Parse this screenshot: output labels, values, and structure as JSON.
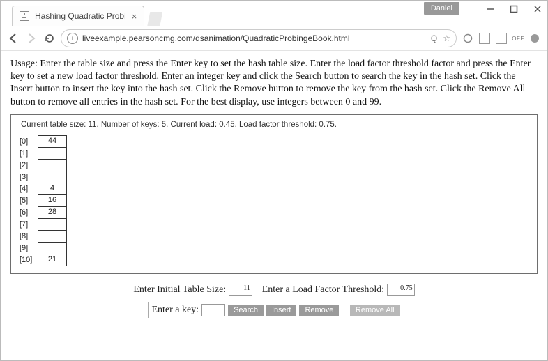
{
  "window": {
    "user_chip": "Daniel"
  },
  "tab": {
    "title": "Hashing Quadratic Probi"
  },
  "omnibox": {
    "url": "liveexample.pearsoncmg.com/dsanimation/QuadraticProbingeBook.html",
    "zoom_glyph": "Q",
    "star_glyph": "☆"
  },
  "ext": {
    "off_label": "OFF"
  },
  "page": {
    "usage": "Usage: Enter the table size and press the Enter key to set the hash table size. Enter the load factor threshold factor and press the Enter key to set a new load factor threshold. Enter an integer key and click the Search button to search the key in the hash set. Click the Insert button to insert the key into the hash set. Click the Remove button to remove the key from the hash set. Click the Remove All button to remove all entries in the hash set. For the best display, use integers between 0 and 99.",
    "status": "Current table size: 11. Number of keys: 5. Current load: 0.45. Load factor threshold: 0.75.",
    "table": [
      {
        "index": "[0]",
        "value": "44"
      },
      {
        "index": "[1]",
        "value": ""
      },
      {
        "index": "[2]",
        "value": ""
      },
      {
        "index": "[3]",
        "value": ""
      },
      {
        "index": "[4]",
        "value": "4"
      },
      {
        "index": "[5]",
        "value": "16"
      },
      {
        "index": "[6]",
        "value": "28"
      },
      {
        "index": "[7]",
        "value": ""
      },
      {
        "index": "[8]",
        "value": ""
      },
      {
        "index": "[9]",
        "value": ""
      },
      {
        "index": "[10]",
        "value": "21"
      }
    ],
    "controls": {
      "size_label": "Enter Initial Table Size:",
      "size_value": "11",
      "load_label": "Enter a Load Factor Threshold:",
      "load_value": "0.75",
      "key_label": "Enter a key:",
      "search": "Search",
      "insert": "Insert",
      "remove": "Remove",
      "remove_all": "Remove All"
    }
  }
}
